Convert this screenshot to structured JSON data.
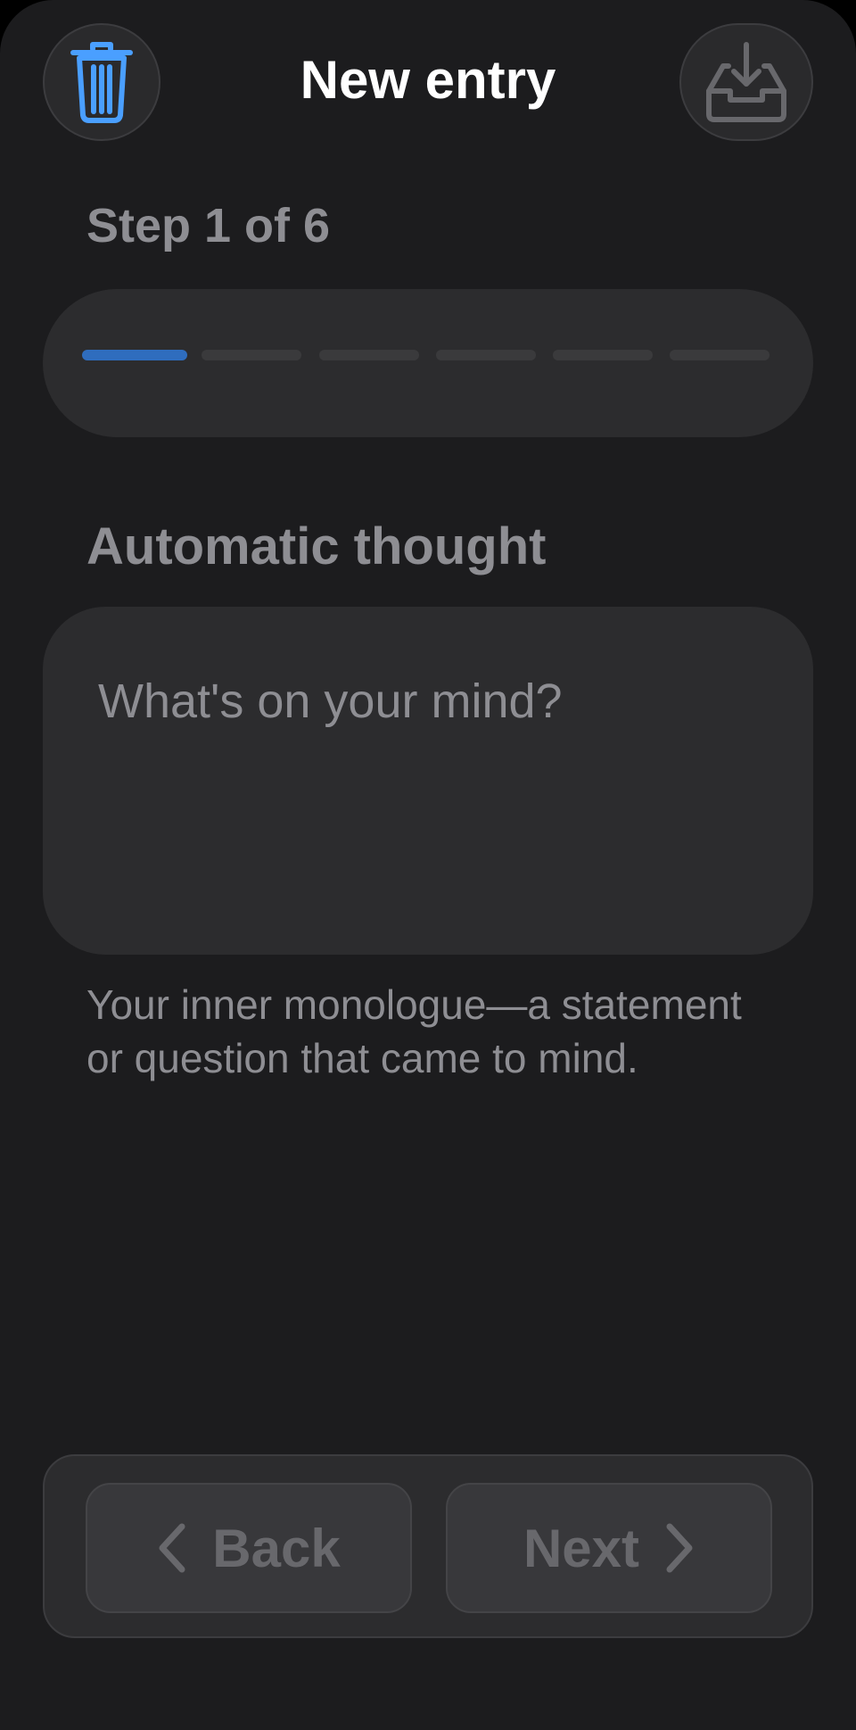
{
  "header": {
    "title": "New entry",
    "delete_icon": "trash-icon",
    "save_icon": "tray-download-icon"
  },
  "progress": {
    "step_label": "Step 1 of 6",
    "current_step": 1,
    "total_steps": 6
  },
  "thought": {
    "label": "Automatic thought",
    "placeholder": "What's on your mind?",
    "value": "",
    "helper": "Your inner monologue—a statement or question that came to mind."
  },
  "nav": {
    "back_label": "Back",
    "next_label": "Next",
    "back_icon": "chevron-left-icon",
    "next_icon": "chevron-right-icon"
  },
  "colors": {
    "background": "#1c1c1e",
    "card": "#2c2c2e",
    "accent": "#2f6dbe",
    "trash_icon": "#4a9fff",
    "secondary_text": "#8e8e93",
    "disabled_text": "#68686c"
  }
}
